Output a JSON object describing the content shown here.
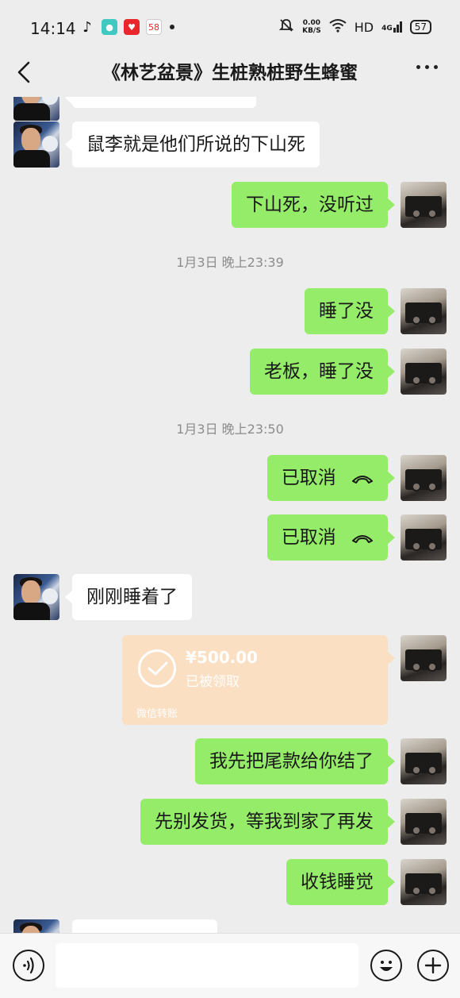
{
  "status_bar": {
    "time": "14:14",
    "net_speed_value": "0.00",
    "net_speed_unit": "KB/S",
    "hd_label": "HD",
    "network_label": "4G",
    "battery": "57",
    "app_58_label": "58"
  },
  "header": {
    "title": "《林艺盆景》生桩熟桩野生蜂蜜"
  },
  "messages": [
    {
      "side": "left",
      "text": "鼠李就是他们所说的下山死"
    },
    {
      "side": "right",
      "text": "下山死，没听过"
    },
    {
      "type": "timestamp",
      "text": "1月3日 晚上23:39"
    },
    {
      "side": "right",
      "text": "睡了没"
    },
    {
      "side": "right",
      "text": "老板，睡了没"
    },
    {
      "type": "timestamp",
      "text": "1月3日 晚上23:50"
    },
    {
      "side": "right",
      "text": "已取消",
      "icon": "hangup-icon"
    },
    {
      "side": "right",
      "text": "已取消",
      "icon": "hangup-icon"
    },
    {
      "side": "left",
      "text": "刚刚睡着了"
    },
    {
      "side": "right",
      "type": "transfer",
      "amount": "¥500.00",
      "status": "已被领取",
      "source": "微信转账"
    },
    {
      "side": "right",
      "text": "我先把尾款给你结了"
    },
    {
      "side": "right",
      "text": "先别发货，等我到家了再发"
    },
    {
      "side": "right",
      "text": "收钱睡觉"
    }
  ],
  "colors": {
    "background": "#ededed",
    "bubble_self": "#95ec69",
    "bubble_other": "#ffffff",
    "transfer_received": "#fbdfc2",
    "timestamp_text": "#8c8c8c"
  },
  "input_bar": {
    "placeholder": ""
  }
}
